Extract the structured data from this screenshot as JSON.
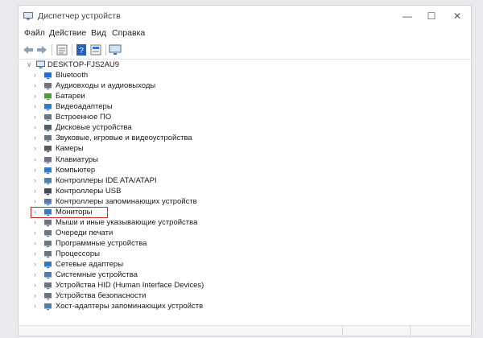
{
  "window": {
    "title": "Диспетчер устройств",
    "controls": {
      "minimize": "—",
      "maximize": "☐",
      "close": "✕"
    }
  },
  "menu": [
    "Файл",
    "Действие",
    "Вид",
    "Справка"
  ],
  "toolbar": {
    "buttons": [
      "back-arrow-icon",
      "forward-arrow-icon",
      "properties-icon",
      "help-icon",
      "monitor-scan-icon"
    ]
  },
  "tree": {
    "root": {
      "label": "DESKTOP-FJS2AU9",
      "expanded": true
    },
    "items": [
      {
        "label": "Bluetooth",
        "icon": "bluetooth-icon"
      },
      {
        "label": "Аудиовходы и аудиовыходы",
        "icon": "speaker-icon"
      },
      {
        "label": "Батареи",
        "icon": "battery-icon"
      },
      {
        "label": "Видеоадаптеры",
        "icon": "display-adapter-icon"
      },
      {
        "label": "Встроенное ПО",
        "icon": "firmware-icon"
      },
      {
        "label": "Дисковые устройства",
        "icon": "disk-drive-icon"
      },
      {
        "label": "Звуковые, игровые и видеоустройства",
        "icon": "sound-icon"
      },
      {
        "label": "Камеры",
        "icon": "camera-icon"
      },
      {
        "label": "Клавиатуры",
        "icon": "keyboard-icon"
      },
      {
        "label": "Компьютер",
        "icon": "computer-icon"
      },
      {
        "label": "Контроллеры IDE ATA/ATAPI",
        "icon": "ide-controller-icon"
      },
      {
        "label": "Контроллеры USB",
        "icon": "usb-icon"
      },
      {
        "label": "Контроллеры запоминающих устройств",
        "icon": "storage-controller-icon"
      },
      {
        "label": "Мониторы",
        "icon": "monitor-icon",
        "highlighted": true
      },
      {
        "label": "Мыши и иные указывающие устройства",
        "icon": "mouse-icon"
      },
      {
        "label": "Очереди печати",
        "icon": "printer-icon"
      },
      {
        "label": "Программные устройства",
        "icon": "software-device-icon"
      },
      {
        "label": "Процессоры",
        "icon": "processor-icon"
      },
      {
        "label": "Сетевые адаптеры",
        "icon": "network-adapter-icon"
      },
      {
        "label": "Системные устройства",
        "icon": "system-device-icon"
      },
      {
        "label": "Устройства HID (Human Interface Devices)",
        "icon": "hid-icon"
      },
      {
        "label": "Устройства безопасности",
        "icon": "security-device-icon"
      },
      {
        "label": "Хост-адаптеры запоминающих устройств",
        "icon": "storage-host-icon"
      }
    ]
  },
  "colors": {
    "highlight": "#c62828",
    "accent": "#2b78d6",
    "icon_grey": "#6b7480"
  }
}
